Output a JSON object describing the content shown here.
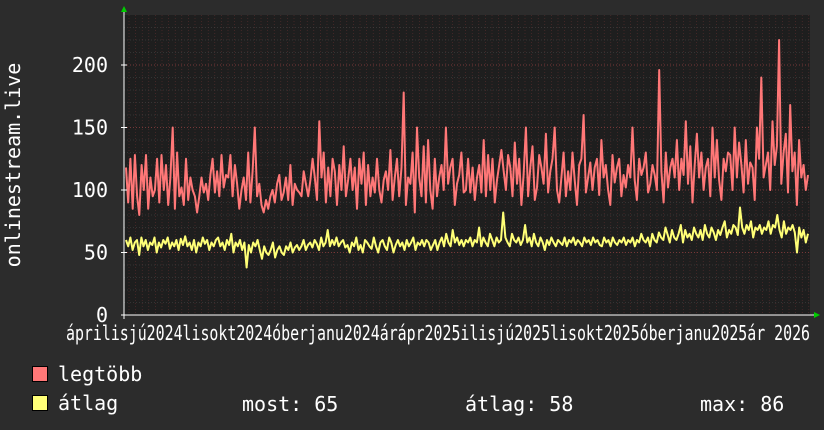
{
  "chart_data": {
    "type": "line",
    "ylabel": "onlinestream.live",
    "ylim": [
      0,
      240
    ],
    "yticks": [
      0,
      50,
      100,
      150,
      200
    ],
    "grid": true,
    "x_start": "2024-03",
    "x_end": "2026-02",
    "xtick_labels": [
      "április",
      "július",
      "2024",
      "október",
      "2024",
      "január",
      "2024",
      "április",
      "2025",
      "július",
      "2025",
      "október",
      "2025",
      "január",
      "2025",
      "április",
      "2026"
    ],
    "xtick_label_line": "áprilisjú2024lisokt2024óberjanu2024árápr2025ilisjú2025lisokt2025óberjanu2025ár 2026",
    "series": [
      {
        "name": "legtöbb",
        "color": "#ff7777",
        "values": [
          118,
          90,
          125,
          85,
          128,
          95,
          80,
          120,
          100,
          128,
          85,
          110,
          95,
          100,
          125,
          90,
          128,
          100,
          120,
          88,
          110,
          150,
          85,
          130,
          95,
          102,
          88,
          125,
          92,
          110,
          100,
          95,
          82,
          95,
          110,
          98,
          105,
          92,
          112,
          125,
          98,
          115,
          95,
          128,
          102,
          112,
          110,
          128,
          95,
          120,
          105,
          85,
          100,
          110,
          92,
          130,
          90,
          115,
          150,
          95,
          105,
          88,
          82,
          92,
          85,
          95,
          100,
          90,
          105,
          112,
          92,
          98,
          110,
          92,
          120,
          88,
          105,
          100,
          98,
          95,
          115,
          105,
          95,
          108,
          125,
          110,
          92,
          155,
          110,
          130,
          90,
          118,
          95,
          125,
          115,
          88,
          120,
          100,
          135,
          95,
          108,
          125,
          100,
          118,
          85,
          125,
          105,
          130,
          88,
          120,
          95,
          110,
          98,
          125,
          100,
          90,
          108,
          115,
          100,
          132,
          92,
          110,
          125,
          95,
          118,
          178,
          88,
          110,
          105,
          130,
          82,
          150,
          110,
          95,
          135,
          90,
          140,
          100,
          85,
          125,
          95,
          110,
          120,
          100,
          150,
          105,
          118,
          125,
          88,
          105,
          112,
          130,
          98,
          100,
          125,
          98,
          118,
          92,
          110,
          120,
          98,
          140,
          95,
          128,
          100,
          125,
          90,
          108,
          120,
          132,
          115,
          100,
          128,
          118,
          95,
          138,
          105,
          125,
          88,
          112,
          150,
          95,
          118,
          135,
          92,
          102,
          128,
          118,
          105,
          145,
          98,
          115,
          125,
          150,
          100,
          90,
          110,
          130,
          95,
          115,
          100,
          130,
          108,
          88,
          120,
          125,
          160,
          98,
          110,
          122,
          100,
          118,
          125,
          96,
          140,
          110,
          120,
          100,
          88,
          128,
          106,
          118,
          125,
          95,
          112,
          102,
          120,
          110,
          150,
          108,
          92,
          125,
          112,
          118,
          130,
          98,
          105,
          120,
          112,
          100,
          196,
          115,
          90,
          130,
          102,
          118,
          125,
          110,
          140,
          100,
          125,
          112,
          155,
          105,
          135,
          90,
          120,
          145,
          110,
          130,
          100,
          118,
          125,
          95,
          150,
          110,
          140,
          108,
          92,
          125,
          115,
          130,
          128,
          100,
          150,
          110,
          138,
          120,
          98,
          140,
          105,
          122,
          118,
          92,
          150,
          125,
          190,
          110,
          120,
          130,
          100,
          155,
          120,
          135,
          220,
          105,
          130,
          145,
          98,
          168,
          115,
          130,
          88,
          140,
          110,
          120,
          100,
          112
        ]
      },
      {
        "name": "átlag",
        "color": "#ffff77",
        "values": [
          60,
          55,
          62,
          52,
          58,
          60,
          48,
          62,
          55,
          60,
          52,
          58,
          56,
          62,
          50,
          58,
          54,
          60,
          57,
          62,
          53,
          58,
          55,
          60,
          52,
          61,
          56,
          63,
          55,
          58,
          52,
          60,
          50,
          58,
          55,
          62,
          57,
          60,
          52,
          58,
          55,
          60,
          62,
          55,
          58,
          52,
          60,
          56,
          65,
          50,
          58,
          55,
          60,
          52,
          58,
          38,
          56,
          50,
          58,
          55,
          60,
          52,
          45,
          55,
          50,
          48,
          52,
          58,
          46,
          52,
          55,
          50,
          48,
          55,
          52,
          58,
          50,
          54,
          56,
          52,
          55,
          60,
          52,
          56,
          58,
          54,
          60,
          57,
          52,
          62,
          55,
          58,
          68,
          55,
          60,
          56,
          62,
          55,
          58,
          60,
          54,
          56,
          50,
          58,
          55,
          62,
          52,
          56,
          50,
          60,
          58,
          55,
          53,
          62,
          55,
          50,
          58,
          60,
          55,
          52,
          62,
          58,
          50,
          56,
          60,
          55,
          58,
          52,
          60,
          55,
          58,
          62,
          52,
          58,
          56,
          60,
          55,
          60,
          58,
          52,
          56,
          60,
          52,
          58,
          62,
          55,
          65,
          58,
          55,
          68,
          58,
          62,
          56,
          60,
          55,
          60,
          58,
          62,
          55,
          60,
          58,
          70,
          55,
          62,
          58,
          55,
          65,
          60,
          55,
          62,
          58,
          60,
          82,
          62,
          58,
          55,
          65,
          60,
          58,
          62,
          56,
          60,
          72,
          58,
          62,
          55,
          65,
          58,
          55,
          62,
          58,
          52,
          60,
          56,
          62,
          58,
          55,
          60,
          58,
          56,
          62,
          55,
          60,
          58,
          62,
          56,
          60,
          58,
          55,
          62,
          58,
          60,
          56,
          62,
          58,
          60,
          56,
          55,
          62,
          58,
          60,
          55,
          62,
          58,
          56,
          60,
          58,
          62,
          56,
          60,
          58,
          62,
          55,
          60,
          58,
          65,
          60,
          58,
          62,
          55,
          65,
          60,
          58,
          66,
          62,
          60,
          70,
          64,
          58,
          68,
          62,
          60,
          65,
          72,
          58,
          68,
          62,
          65,
          60,
          70,
          65,
          62,
          68,
          60,
          72,
          65,
          62,
          70,
          66,
          60,
          68,
          64,
          70,
          75,
          62,
          68,
          65,
          72,
          70,
          64,
          86,
          70,
          65,
          72,
          68,
          75,
          62,
          70,
          68,
          72,
          65,
          70,
          68,
          75,
          65,
          72,
          70,
          80,
          68,
          62,
          75,
          65,
          70,
          68,
          72,
          66,
          50,
          70,
          62,
          68,
          58,
          65
        ]
      }
    ],
    "legend": [
      {
        "name": "legtöbb",
        "color": "#ff7777"
      },
      {
        "name": "átlag",
        "color": "#ffff77"
      }
    ],
    "stats": {
      "most": "most: 65",
      "atlag": "átlag: 58",
      "max": "max: 86"
    }
  }
}
